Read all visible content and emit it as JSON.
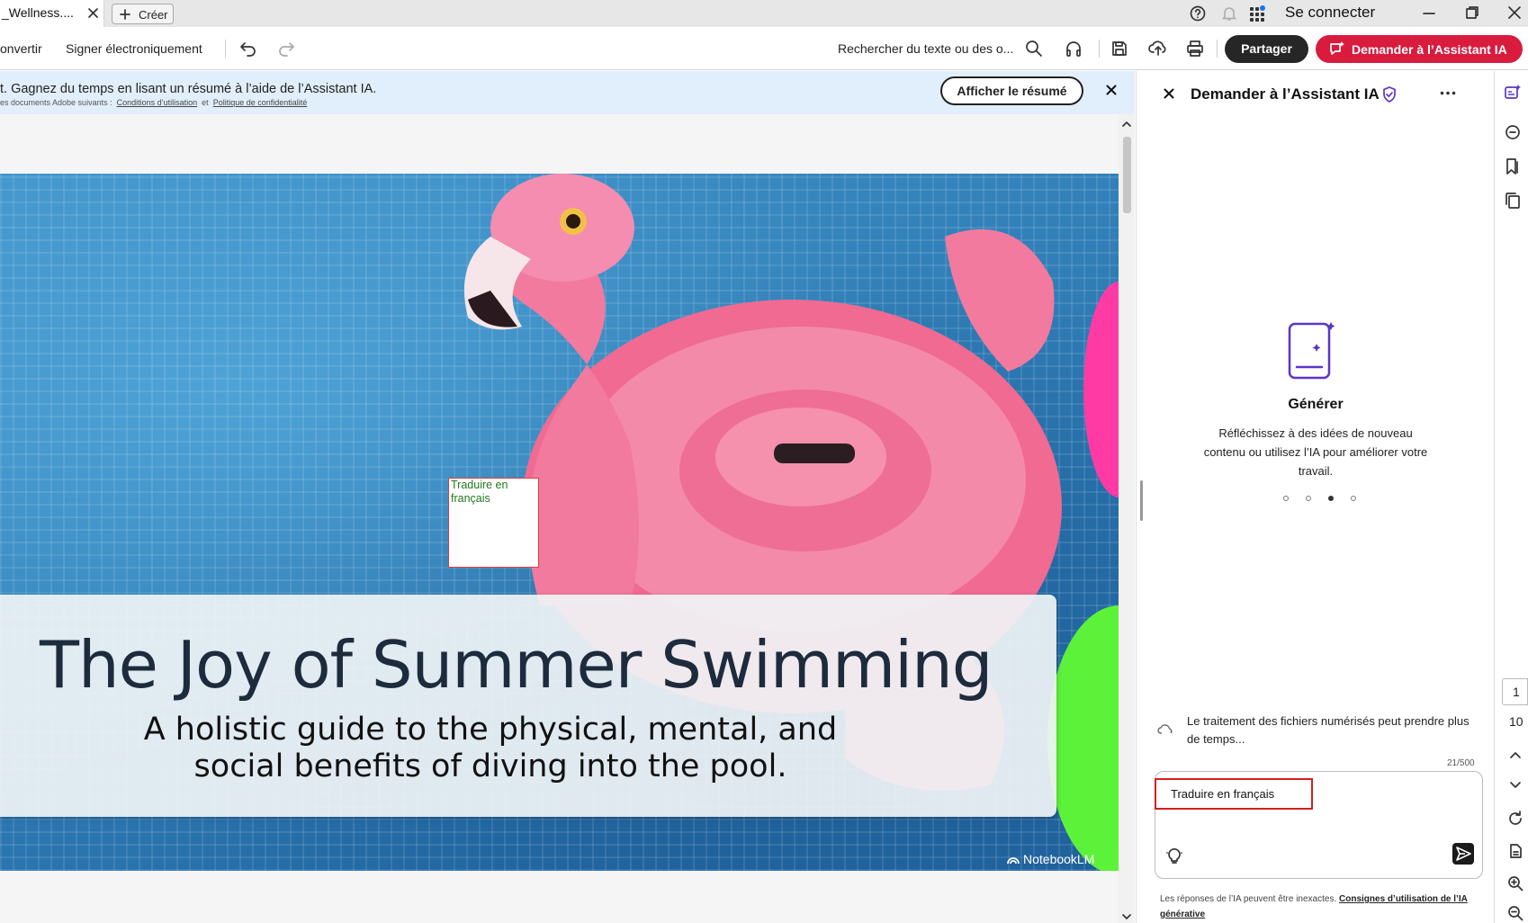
{
  "titlebar": {
    "tab_title": "_Wellness....",
    "create_label": "Créer",
    "signin_label": "Se connecter"
  },
  "toolbar": {
    "convert_label": "onvertir",
    "sign_label": "Signer électroniquement",
    "search_placeholder": "Rechercher du texte ou des o...",
    "share_label": "Partager",
    "ai_label": "Demander à l’Assistant IA"
  },
  "banner": {
    "main_text": "t. Gagnez du temps en lisant un résumé à l’aide de l’Assistant IA.",
    "sub_prefix": "es documents Adobe suivants :",
    "terms_link": "Conditions d’utilisation",
    "sub_and": "et",
    "privacy_link": "Politique de confidentialité",
    "summary_button": "Afficher le résumé"
  },
  "document": {
    "annotation_text": "Traduire en français",
    "title": "The Joy of Summer Swimming",
    "subtitle": "A holistic guide to the physical, mental, and social benefits of diving into the pool.",
    "watermark": "NotebookLM"
  },
  "assistant": {
    "title": "Demander à l’Assistant IA",
    "card_title": "Générer",
    "card_description": "Réfléchissez à des idées de nouveau contenu ou utilisez l’IA pour améliorer votre travail.",
    "scan_notice": "Le traitement des fichiers numérisés peut prendre plus de temps...",
    "char_counter": "21/500",
    "input_value": "Traduire en français",
    "disclaimer_text": "Les réponses de l’IA peuvent être inexactes.",
    "disclaimer_link": "Consignes d’utilisation de l’IA générative",
    "carousel_active_index": 3
  },
  "rail": {
    "current_page": "1",
    "total_pages": "10"
  },
  "colors": {
    "ai_red": "#d91b3e",
    "purple": "#5a35c9",
    "banner_blue": "#e1eefb"
  }
}
